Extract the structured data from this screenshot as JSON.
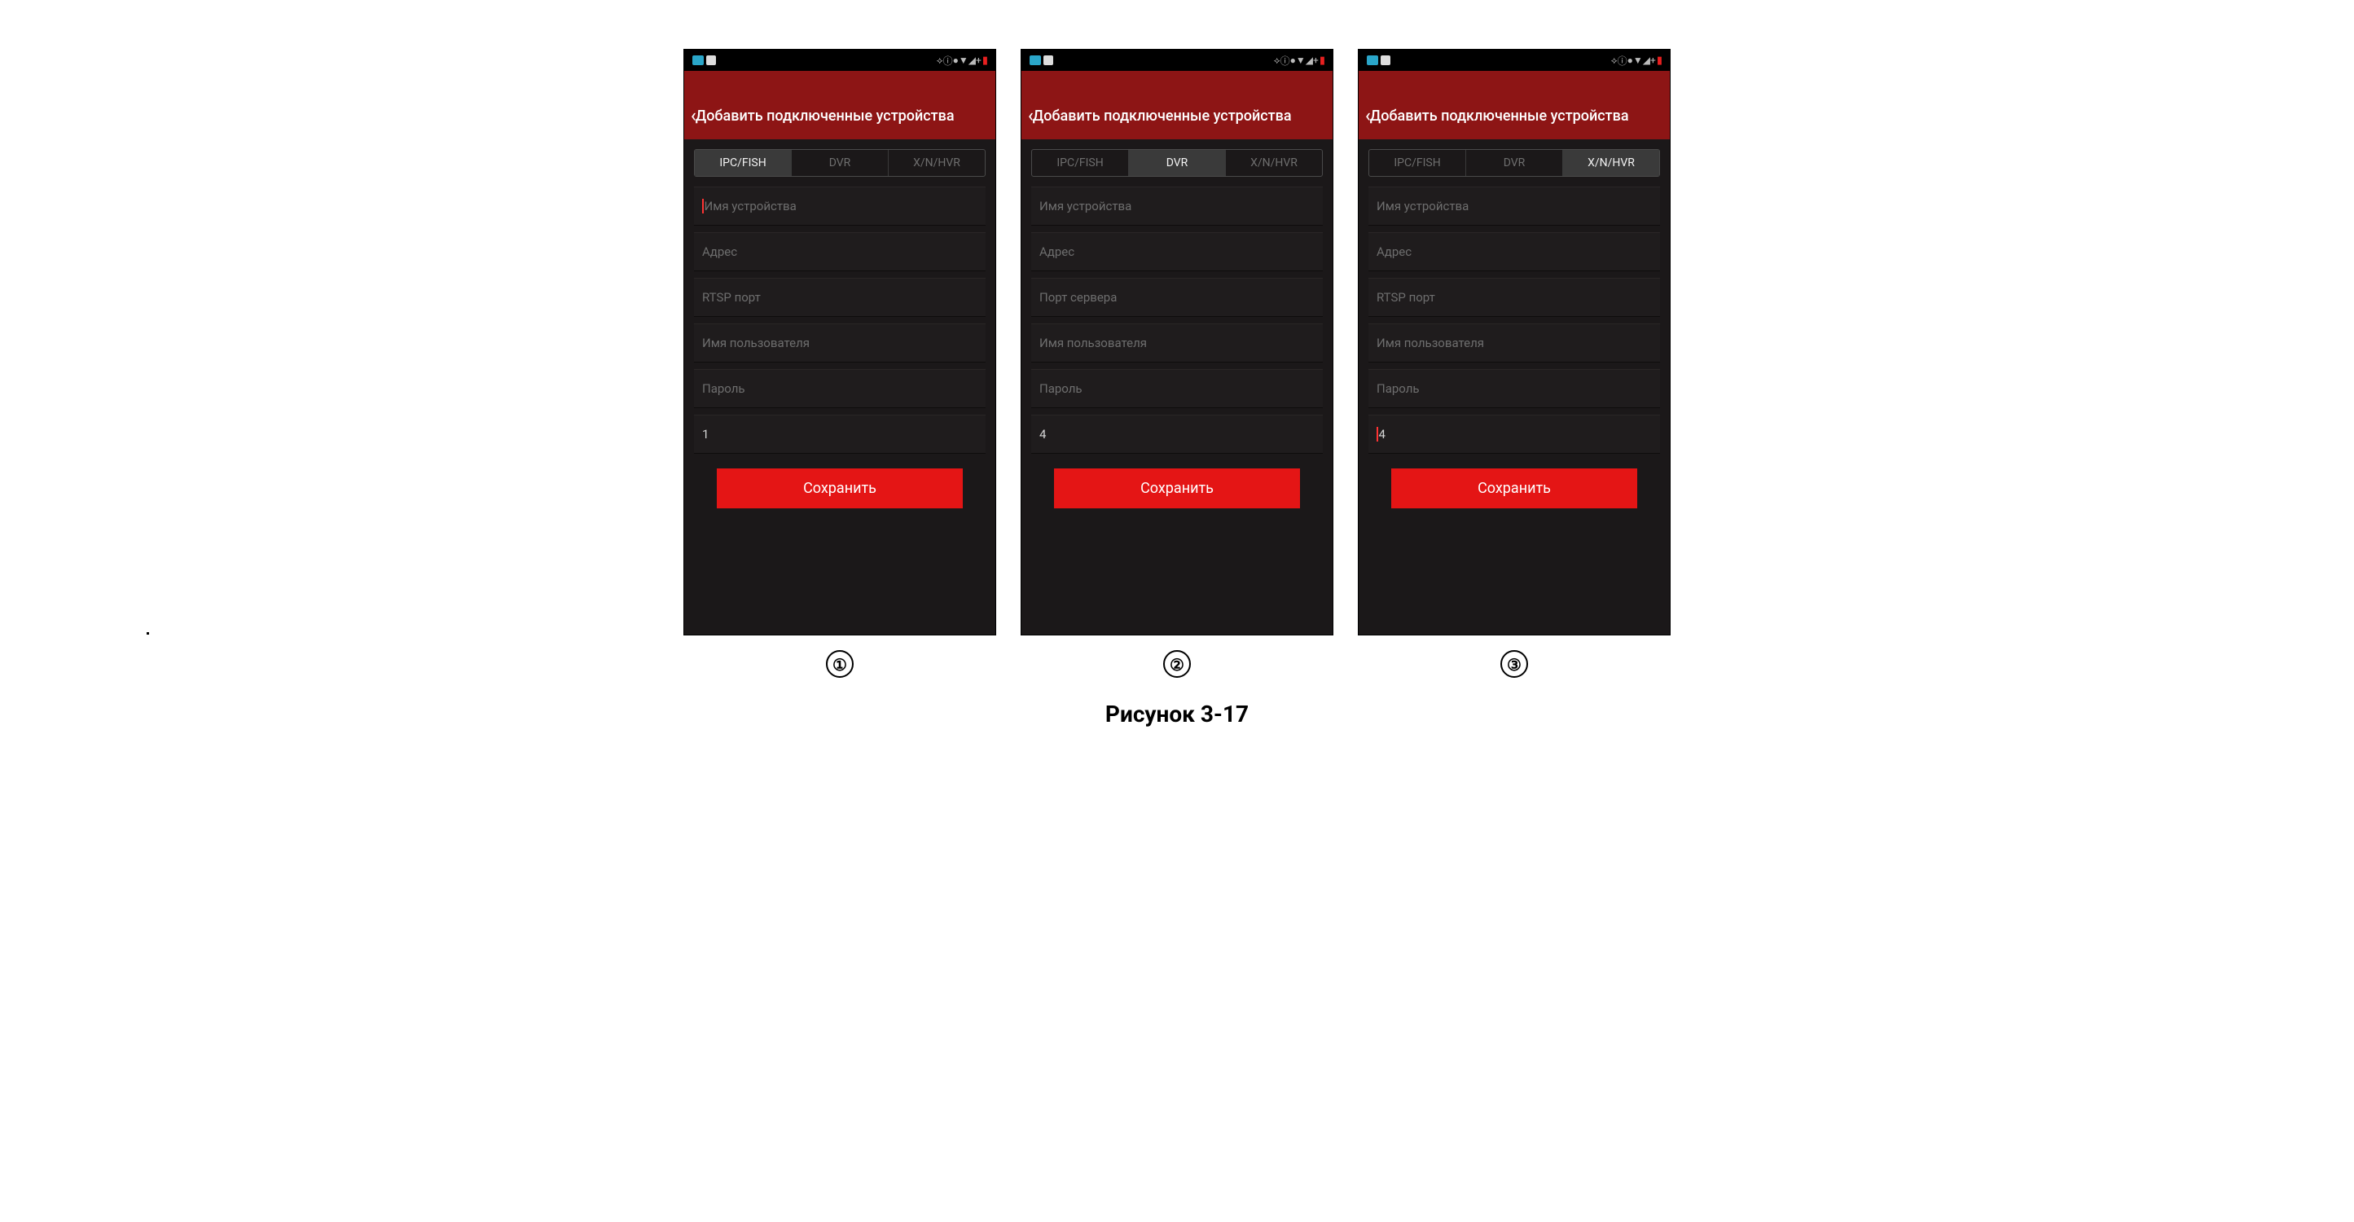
{
  "caption": "Рисунок 3-17",
  "labels": [
    "①",
    "②",
    "③"
  ],
  "common": {
    "header": "Добавить подключенные устройства",
    "save": "Сохранить",
    "tabs": [
      "IPC/FISH",
      "DVR",
      "X/N/HVR"
    ]
  },
  "screens": [
    {
      "activeTab": 0,
      "fields": [
        {
          "placeholder": "Имя устройства",
          "value": "",
          "cursor": true
        },
        {
          "placeholder": "Адрес",
          "value": ""
        },
        {
          "placeholder": "RTSP порт",
          "value": ""
        },
        {
          "placeholder": "Имя пользователя",
          "value": ""
        },
        {
          "placeholder": "Пароль",
          "value": ""
        },
        {
          "placeholder": "",
          "value": "1"
        }
      ]
    },
    {
      "activeTab": 1,
      "fields": [
        {
          "placeholder": "Имя устройства",
          "value": ""
        },
        {
          "placeholder": "Адрес",
          "value": ""
        },
        {
          "placeholder": "Порт сервера",
          "value": ""
        },
        {
          "placeholder": "Имя пользователя",
          "value": ""
        },
        {
          "placeholder": "Пароль",
          "value": ""
        },
        {
          "placeholder": "",
          "value": "4"
        }
      ]
    },
    {
      "activeTab": 2,
      "fields": [
        {
          "placeholder": "Имя устройства",
          "value": ""
        },
        {
          "placeholder": "Адрес",
          "value": ""
        },
        {
          "placeholder": "RTSP порт",
          "value": ""
        },
        {
          "placeholder": "Имя пользователя",
          "value": ""
        },
        {
          "placeholder": "Пароль",
          "value": ""
        },
        {
          "placeholder": "",
          "value": "4",
          "cursor": true
        }
      ]
    }
  ]
}
